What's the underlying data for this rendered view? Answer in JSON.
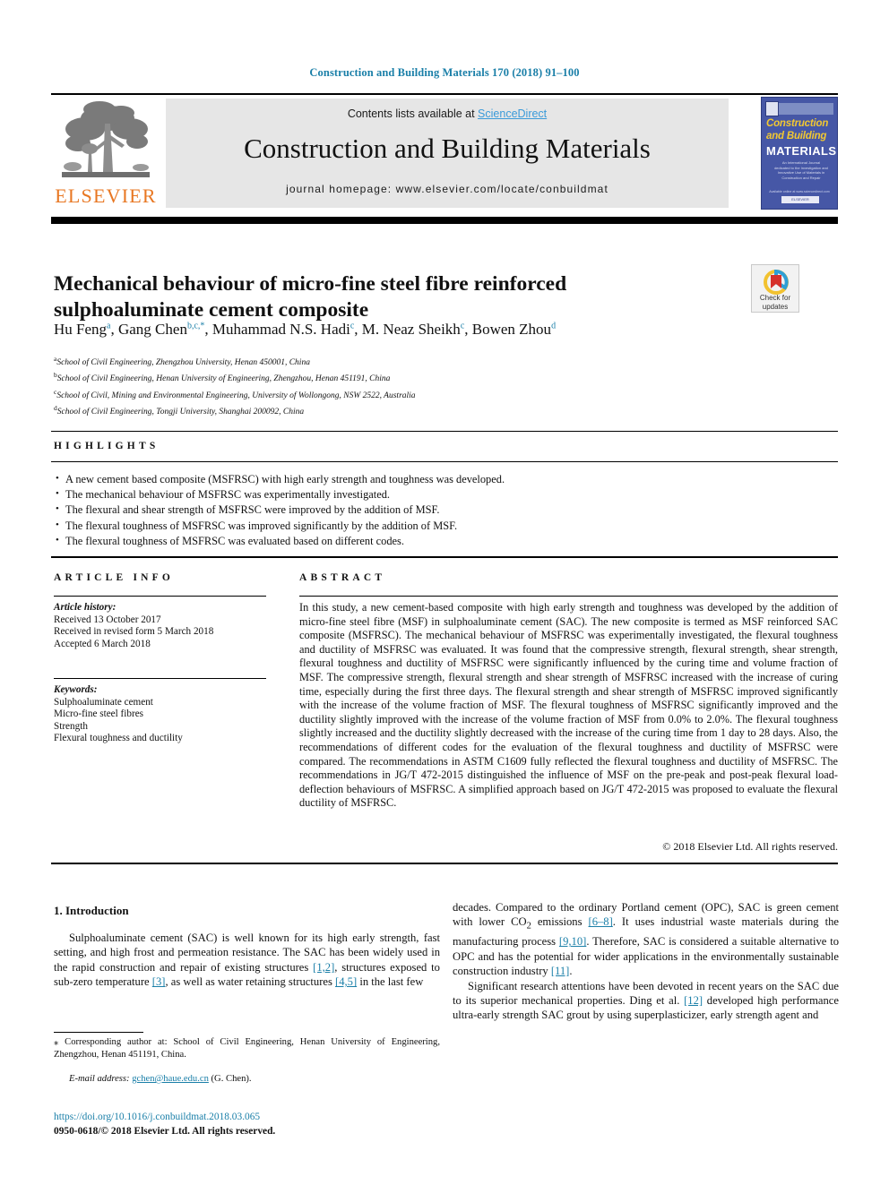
{
  "running_head": "Construction and Building Materials 170 (2018) 91–100",
  "masthead": {
    "contents_prefix": "Contents lists available at ",
    "sciencedirect": "ScienceDirect",
    "journal_title": "Construction and Building Materials",
    "homepage": "journal homepage: www.elsevier.com/locate/conbuildmat",
    "publisher_wordmark": "ELSEVIER",
    "cover": {
      "line1": "Construction",
      "line2": "and Building",
      "line3": "MATERIALS",
      "blurb": "An International Journal dedicated to the Investigation and Innovative Use of Materials in Construction and Repair",
      "footer": "ELSEVIER",
      "credit": "Available online at www.sciencedirect.com"
    },
    "colors": {
      "link": "#3a9ad9",
      "running_head": "#1a7fa8",
      "elsevier_orange": "#E87722",
      "cover_bg": "#4657a6",
      "band_bg": "#e6e6e6"
    }
  },
  "article": {
    "title": "Mechanical behaviour of micro-fine steel fibre reinforced sulphoaluminate cement composite",
    "updates_badge": {
      "line1": "Check for",
      "line2": "updates"
    },
    "authors": [
      {
        "name": "Hu Feng",
        "sup": "a",
        "sep": ", "
      },
      {
        "name": "Gang Chen",
        "sup": "b,c,*",
        "sep": ", "
      },
      {
        "name": "Muhammad N.S. Hadi",
        "sup": "c",
        "sep": ", "
      },
      {
        "name": "M. Neaz Sheikh",
        "sup": "c",
        "sep": ", "
      },
      {
        "name": "Bowen Zhou",
        "sup": "d",
        "sep": ""
      }
    ],
    "affiliations": [
      {
        "sup": "a",
        "text": "School of Civil Engineering, Zhengzhou University, Henan 450001, China"
      },
      {
        "sup": "b",
        "text": "School of Civil Engineering, Henan University of Engineering, Zhengzhou, Henan 451191, China"
      },
      {
        "sup": "c",
        "text": "School of Civil, Mining and Environmental Engineering, University of Wollongong, NSW 2522, Australia"
      },
      {
        "sup": "d",
        "text": "School of Civil Engineering, Tongji University, Shanghai 200092, China"
      }
    ]
  },
  "highlights": {
    "heading": "HIGHLIGHTS",
    "items": [
      "A new cement based composite (MSFRSC) with high early strength and toughness was developed.",
      "The mechanical behaviour of MSFRSC was experimentally investigated.",
      "The flexural and shear strength of MSFRSC were improved by the addition of MSF.",
      "The flexural toughness of MSFRSC was improved significantly by the addition of MSF.",
      "The flexural toughness of MSFRSC was evaluated based on different codes."
    ]
  },
  "article_info": {
    "heading": "ARTICLE INFO",
    "history_label": "Article history:",
    "history": [
      "Received 13 October 2017",
      "Received in revised form 5 March 2018",
      "Accepted 6 March 2018"
    ],
    "keywords_label": "Keywords:",
    "keywords": [
      "Sulphoaluminate cement",
      "Micro-fine steel fibres",
      "Strength",
      "Flexural toughness and ductility"
    ]
  },
  "abstract": {
    "heading": "ABSTRACT",
    "text": "In this study, a new cement-based composite with high early strength and toughness was developed by the addition of micro-fine steel fibre (MSF) in sulphoaluminate cement (SAC). The new composite is termed as MSF reinforced SAC composite (MSFRSC). The mechanical behaviour of MSFRSC was experimentally investigated, the flexural toughness and ductility of MSFRSC was evaluated. It was found that the compressive strength, flexural strength, shear strength, flexural toughness and ductility of MSFRSC were significantly influenced by the curing time and volume fraction of MSF. The compressive strength, flexural strength and shear strength of MSFRSC increased with the increase of curing time, especially during the first three days. The flexural strength and shear strength of MSFRSC improved significantly with the increase of the volume fraction of MSF. The flexural toughness of MSFRSC significantly improved and the ductility slightly improved with the increase of the volume fraction of MSF from 0.0% to 2.0%. The flexural toughness slightly increased and the ductility slightly decreased with the increase of the curing time from 1 day to 28 days. Also, the recommendations of different codes for the evaluation of the flexural toughness and ductility of MSFRSC were compared. The recommendations in ASTM C1609 fully reflected the flexural toughness and ductility of MSFRSC. The recommendations in JG/T 472-2015 distinguished the influence of MSF on the pre-peak and post-peak flexural load-deflection behaviours of MSFRSC. A simplified approach based on JG/T 472-2015 was proposed to evaluate the flexural ductility of MSFRSC.",
    "copyright": "© 2018 Elsevier Ltd. All rights reserved."
  },
  "body": {
    "section_heading": "1. Introduction",
    "left_paragraph_1_a": "Sulphoaluminate cement (SAC) is well known for its high early strength, fast setting, and high frost and permeation resistance. The SAC has been widely used in the rapid construction and repair of existing structures ",
    "ref_1_2": "[1,2]",
    "left_paragraph_1_b": ", structures exposed to sub-zero temperature ",
    "ref_3": "[3]",
    "left_paragraph_1_c": ", as well as water retaining structures ",
    "ref_4_5": "[4,5]",
    "left_paragraph_1_d": " in the last few",
    "right_paragraph_1_a": "decades. Compared to the ordinary Portland cement (OPC), SAC is green cement with lower CO",
    "co2_sub": "2",
    "right_paragraph_1_b": " emissions ",
    "ref_6_8": "[6–8]",
    "right_paragraph_1_c": ". It uses industrial waste materials during the manufacturing process ",
    "ref_9_10": "[9,10]",
    "right_paragraph_1_d": ". Therefore, SAC is considered a suitable alternative to OPC and has the potential for wider applications in the environmentally sustainable construction industry ",
    "ref_11": "[11]",
    "right_paragraph_1_e": ".",
    "right_paragraph_2_a": "Significant research attentions have been devoted in recent years on the SAC due to its superior mechanical properties. Ding et al. ",
    "ref_12": "[12]",
    "right_paragraph_2_b": " developed high performance ultra-early strength SAC grout by using superplasticizer, early strength agent and"
  },
  "footer": {
    "corresponding_star": "⁎",
    "corresponding_text": " Corresponding author at: School of Civil Engineering, Henan University of Engineering, Zhengzhou, Henan 451191, China.",
    "email_label": "E-mail address:",
    "email": "gchen@haue.edu.cn",
    "email_owner": "(G. Chen).",
    "doi": "https://doi.org/10.1016/j.conbuildmat.2018.03.065",
    "issn": "0950-0618/© 2018 Elsevier Ltd. All rights reserved."
  }
}
